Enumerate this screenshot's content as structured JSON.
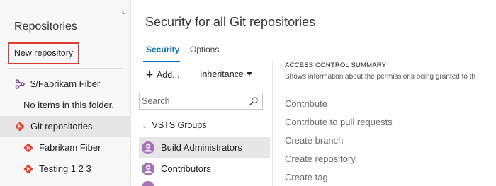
{
  "sidebar": {
    "title": "Repositories",
    "new_repo_label": "New repository",
    "collapse_glyph": "‹",
    "items": [
      {
        "label": "$/Fabrikam Fiber",
        "icon": "tfvc-branch-icon"
      },
      {
        "label": "No items in this folder.",
        "icon": ""
      },
      {
        "label": "Git repositories",
        "icon": "git-icon"
      },
      {
        "label": "Fabrikam Fiber",
        "icon": "git-icon"
      },
      {
        "label": "Testing 1 2 3",
        "icon": "git-icon"
      }
    ]
  },
  "main": {
    "title": "Security for all Git repositories",
    "tabs": [
      {
        "label": "Security",
        "active": true
      },
      {
        "label": "Options",
        "active": false
      }
    ],
    "toolbar": {
      "add_label": "Add...",
      "inheritance_label": "Inheritance"
    },
    "search": {
      "placeholder": "Search"
    },
    "group": {
      "header": "VSTS Groups",
      "items": [
        {
          "label": "Build Administrators",
          "selected": true
        },
        {
          "label": "Contributors",
          "selected": false
        }
      ]
    },
    "access_summary": {
      "title": "ACCESS CONTROL SUMMARY",
      "description": "Shows information about the permissions being granted to th",
      "permissions": [
        "Contribute",
        "Contribute to pull requests",
        "Create branch",
        "Create repository",
        "Create tag"
      ]
    }
  },
  "colors": {
    "accent": "#0a6cc0",
    "highlight_border": "#e03b2f",
    "git_icon": "#e8432e",
    "avatar": "#a575b8"
  }
}
